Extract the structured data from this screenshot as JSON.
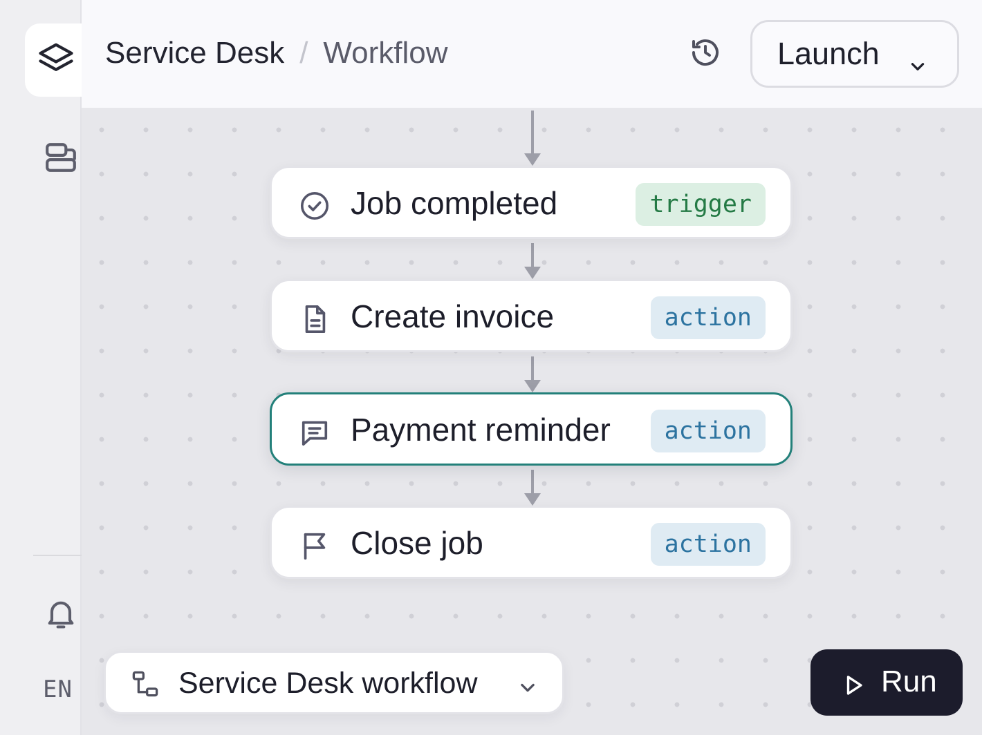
{
  "app": {
    "logo_icon": "layers-icon",
    "rail_icons": [
      "layers-icon",
      "layout-panels-icon",
      "bell-icon"
    ],
    "language": "EN"
  },
  "header": {
    "breadcrumb_root": "Service Desk",
    "breadcrumb_separator": "/",
    "breadcrumb_current": "Workflow",
    "history_icon": "history-icon",
    "launch_label": "Launch"
  },
  "workflow": {
    "nodes": [
      {
        "title": "Job completed",
        "badge": "trigger",
        "icon": "check-circle-icon",
        "selected": false
      },
      {
        "title": "Create invoice",
        "badge": "action",
        "icon": "document-icon",
        "selected": false
      },
      {
        "title": "Payment reminder",
        "badge": "action",
        "icon": "message-icon",
        "selected": true
      },
      {
        "title": "Close job",
        "badge": "action",
        "icon": "flag-icon",
        "selected": false
      }
    ]
  },
  "footer": {
    "workflow_selector_label": "Service Desk workflow",
    "workflow_selector_icon": "workflow-icon",
    "run_label": "Run",
    "run_icon": "play-icon"
  },
  "colors": {
    "selected_border": "#23807a",
    "trigger_badge_bg": "#dcefe3",
    "trigger_badge_text": "#247a45",
    "action_badge_bg": "#dfebf3",
    "action_badge_text": "#2c73a0",
    "run_button_bg": "#1c1c2c"
  }
}
